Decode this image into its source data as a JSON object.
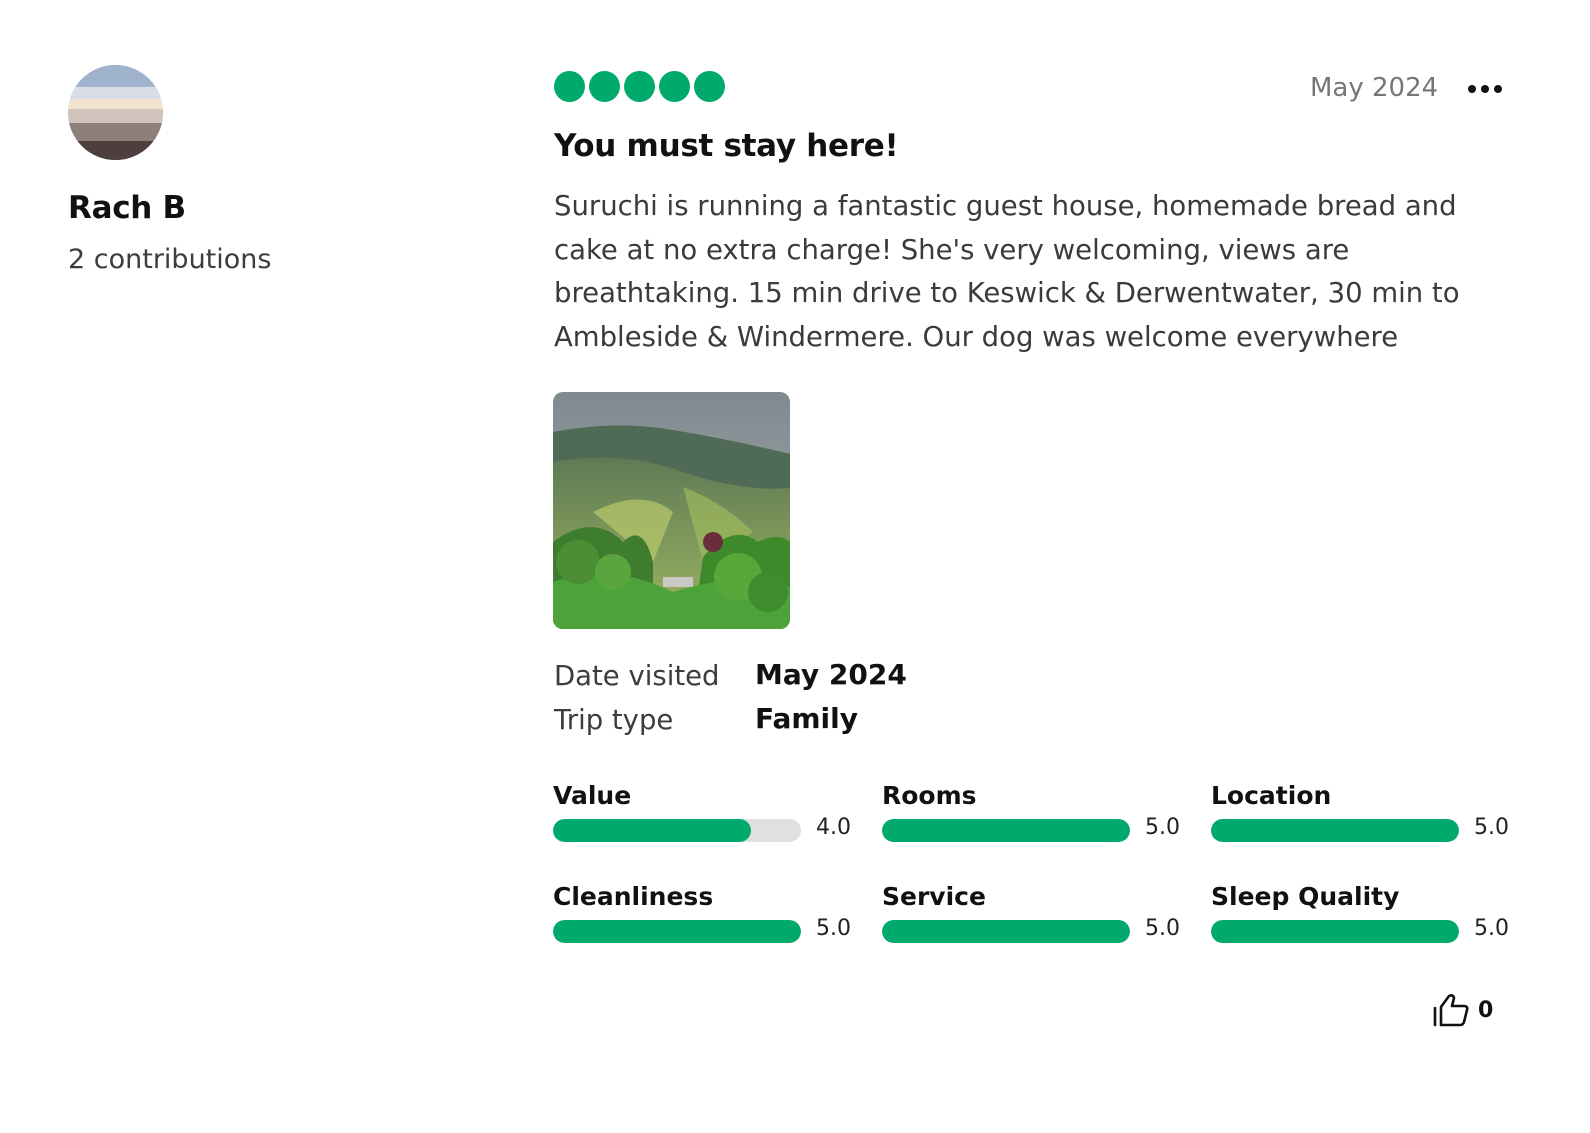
{
  "reviewer": {
    "name": "Rach B",
    "contributions": "2 contributions"
  },
  "review": {
    "bubble_rating": 5,
    "date": "May 2024",
    "title": "You must stay here!",
    "text": "Suruchi is running a fantastic guest house, homemade bread and cake at no extra charge! She's very welcoming, views are breathtaking. 15 min drive to Keswick & Derwentwater, 30 min to Ambleside & Windermere. Our dog was welcome everywhere",
    "photo_icon": "landscape-photo"
  },
  "meta": {
    "date_visited_label": "Date visited",
    "date_visited_value": "May 2024",
    "trip_type_label": "Trip type",
    "trip_type_value": "Family"
  },
  "subratings": [
    {
      "label": "Value",
      "score": "4.0",
      "fraction": 0.8
    },
    {
      "label": "Rooms",
      "score": "5.0",
      "fraction": 1.0
    },
    {
      "label": "Location",
      "score": "5.0",
      "fraction": 1.0
    },
    {
      "label": "Cleanliness",
      "score": "5.0",
      "fraction": 1.0
    },
    {
      "label": "Service",
      "score": "5.0",
      "fraction": 1.0
    },
    {
      "label": "Sleep Quality",
      "score": "5.0",
      "fraction": 1.0
    }
  ],
  "helpful": {
    "count": "0",
    "icon": "thumbs-up-icon"
  },
  "colors": {
    "accent_green": "#00aa6c",
    "track_grey": "#e0e0e0",
    "muted_text": "#767676"
  }
}
